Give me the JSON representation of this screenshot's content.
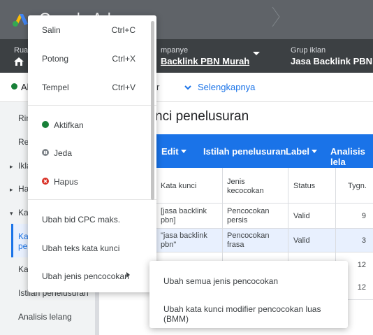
{
  "header": {
    "app_title": "Google Ads"
  },
  "breadcrumb": {
    "account_label": "Ruan",
    "campaign_label": "mpanye",
    "campaign_value": "Backlink PBN Murah",
    "adgroup_label": "Grup iklan",
    "adgroup_value": "Jasa Backlink PBN"
  },
  "filters": {
    "status_text": "Ak",
    "filter_fragment": "r",
    "more_label": "Selengkapnya"
  },
  "leftnav": {
    "items": [
      "Rin",
      "Re",
      "Ikla",
      "Ha",
      "Ka",
      "Ka\npe",
      "Ka",
      "Istilah penelusuran",
      "Analisis lelang"
    ]
  },
  "page": {
    "title": "nci penelusuran"
  },
  "toolbar": {
    "edit": "Edit",
    "search_terms": "Istilah penelusuran",
    "label": "Label",
    "auction": "Analisis lela"
  },
  "table": {
    "headers": [
      "Kata kunci",
      "Jenis\nkecocokan",
      "Status",
      "Tygn."
    ],
    "rows": [
      {
        "keyword": "[jasa backlink\npbn]",
        "match": "Pencocokan\npersis",
        "status": "Valid",
        "impr": "9"
      },
      {
        "keyword": "\"jasa backlink\npbn\"",
        "match": "Pencocokan\nfrasa",
        "status": "Valid",
        "impr": "3"
      },
      {
        "keyword": "",
        "match": "",
        "status": "",
        "impr": "12"
      },
      {
        "keyword": "",
        "match": "",
        "status": "",
        "impr": "12"
      }
    ],
    "close_glyph": "✕"
  },
  "context_menu": {
    "copy": "Salin",
    "copy_shortcut": "Ctrl+C",
    "cut": "Potong",
    "cut_shortcut": "Ctrl+X",
    "paste": "Tempel",
    "paste_shortcut": "Ctrl+V",
    "enable": "Aktifkan",
    "pause": "Jeda",
    "remove": "Hapus",
    "change_bid": "Ubah bid CPC maks.",
    "change_text": "Ubah teks kata kunci",
    "change_match": "Ubah jenis pencocokan"
  },
  "submenu": {
    "change_all": "Ubah semua jenis pencocokan",
    "change_bmm": "Ubah kata kunci modifier pencocokan luas (BMM)"
  },
  "colors": {
    "green": "#188038",
    "grey": "#80868b",
    "red": "#d93025",
    "blue": "#1a73e8"
  }
}
